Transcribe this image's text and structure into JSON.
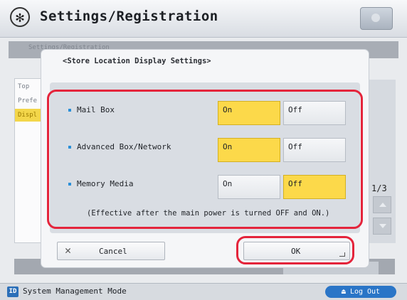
{
  "header": {
    "title": "Settings/Registration",
    "icon": "gear-asterisk-icon"
  },
  "background": {
    "breadcrumb": "Settings/Registration",
    "left_list": [
      "Top",
      "Prefe",
      "Displ"
    ],
    "page_indicator": "1/3"
  },
  "dialog": {
    "title": "<Store Location Display Settings>",
    "rows": [
      {
        "label": "Mail Box",
        "on_label": "On",
        "off_label": "Off",
        "selected": "On"
      },
      {
        "label": "Advanced Box/Network",
        "on_label": "On",
        "off_label": "Off",
        "selected": "On"
      },
      {
        "label": "Memory Media",
        "on_label": "On",
        "off_label": "Off",
        "selected": "Off"
      }
    ],
    "notice": "(Effective after the main power is turned OFF and ON.)",
    "cancel_label": "Cancel",
    "ok_label": "OK"
  },
  "footer": {
    "badge": "ID",
    "mode_text": "System Management Mode",
    "logout_label": "Log Out"
  },
  "colors": {
    "selected": "#fcd94a",
    "highlight": "#e4243b",
    "footer_button": "#2a75c7"
  }
}
